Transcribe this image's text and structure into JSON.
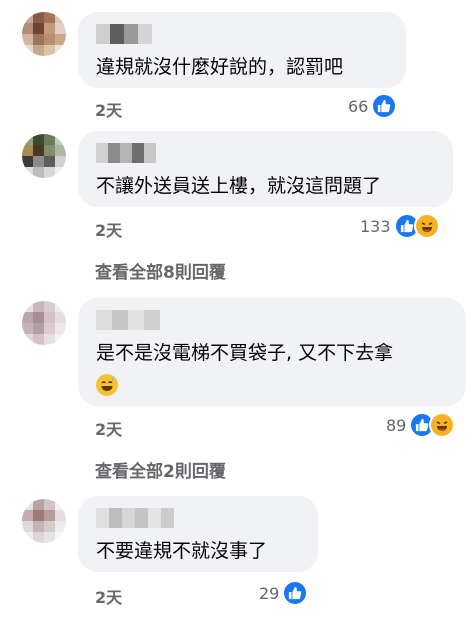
{
  "comments": [
    {
      "text_lines": [
        "違規就沒什麼好說的，認罰吧"
      ],
      "time": "2天",
      "reaction_count": "66",
      "reactions": [
        "like-icon"
      ]
    },
    {
      "text_lines": [
        "不讓外送員送上樓，就沒這問題了"
      ],
      "time": "2天",
      "reaction_count": "133",
      "reactions": [
        "like-icon",
        "haha-icon"
      ],
      "view_replies": "查看全部8則回覆"
    },
    {
      "text_lines": [
        "是不是沒電梯不買袋子, 又不下去拿"
      ],
      "trailing_emoji": "grinning-sweat-emoji",
      "time": "2天",
      "reaction_count": "89",
      "reactions": [
        "like-icon",
        "haha-icon"
      ],
      "view_replies": "查看全部2則回覆"
    },
    {
      "text_lines": [
        "不要違規不就沒事了"
      ],
      "time": "2天",
      "reaction_count": "29",
      "reactions": [
        "like-icon"
      ]
    }
  ],
  "colors": {
    "bubble": "#f0f2f5",
    "meta": "#65676b",
    "like_blue": "#1877f2",
    "haha_yellow": "#f7b125"
  }
}
